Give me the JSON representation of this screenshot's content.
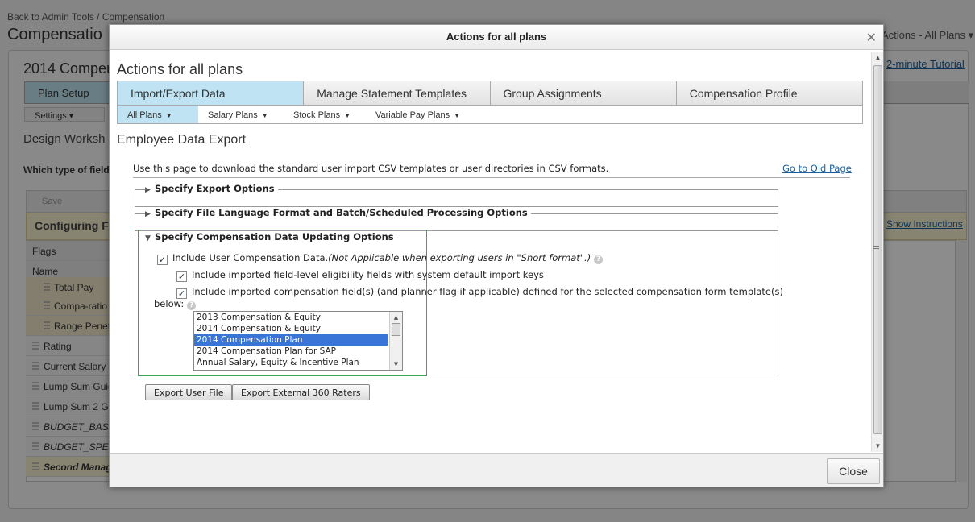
{
  "background": {
    "back_link": "Back to Admin Tools / Compensation",
    "title": "Compensatio",
    "actions": "Actions - All Plans ▾",
    "year_title": "2014 Compen",
    "tutorial": "2-minute Tutorial",
    "plan_setup": "Plan Setup",
    "settings": "Settings ▾",
    "design": "Design Worksh",
    "which_type": "Which type of field",
    "save": "Save",
    "configuring": "Configuring For",
    "show_instructions": "Show Instructions",
    "rows": [
      {
        "label": "Flags"
      },
      {
        "label": "Name"
      },
      {
        "label": "Total Pay"
      },
      {
        "label": "Compa-ratio"
      },
      {
        "label": "Range Penet"
      },
      {
        "label": "Rating"
      },
      {
        "label": "Current Salary"
      },
      {
        "label": "Lump Sum Guid"
      },
      {
        "label": "Lump Sum 2 Gu"
      },
      {
        "label": "BUDGET_BASIS"
      },
      {
        "label": "BUDGET_SPENT"
      },
      {
        "label": "Second Manag"
      }
    ]
  },
  "modal": {
    "title": "Actions for all plans",
    "close_icon": "close-icon",
    "heading": "Actions for all plans",
    "tabs": [
      {
        "label": "Import/Export Data"
      },
      {
        "label": "Manage Statement Templates"
      },
      {
        "label": "Group Assignments"
      },
      {
        "label": "Compensation Profile"
      }
    ],
    "subtabs": [
      {
        "label": "All Plans"
      },
      {
        "label": "Salary Plans"
      },
      {
        "label": "Stock Plans"
      },
      {
        "label": "Variable Pay Plans"
      }
    ],
    "section_heading": "Employee Data Export",
    "intro": "Use this page to download the standard user import CSV templates or user directories in CSV formats.",
    "old_page_link": "Go to Old Page",
    "sections": [
      {
        "label": "Specify Export Options",
        "expanded": false
      },
      {
        "label": "Specify File Language Format and Batch/Scheduled Processing Options",
        "expanded": false
      },
      {
        "label": "Specify Compensation Data Updating Options",
        "expanded": true
      }
    ],
    "options": {
      "include_comp": "Include User Compensation Data.",
      "include_comp_note": "(Not Applicable when exporting users in \"Short format\".)",
      "include_eligibility": "Include imported field-level eligibility fields with system default import keys",
      "include_fields_line1": "Include imported compensation field(s) (and planner flag if applicable) defined for the selected compensation form template(s)",
      "include_fields_line2": "below:"
    },
    "templates": [
      {
        "label": "2013 Compensation & Equity",
        "selected": false
      },
      {
        "label": "2014 Compensation & Equity",
        "selected": false
      },
      {
        "label": "2014 Compensation Plan",
        "selected": true
      },
      {
        "label": "2014 Compensation Plan for SAP",
        "selected": false
      },
      {
        "label": "Annual Salary, Equity & Incentive Plan",
        "selected": false
      }
    ],
    "buttons": {
      "export_user_file": "Export User File",
      "export_360": "Export External 360 Raters",
      "close": "Close"
    }
  }
}
